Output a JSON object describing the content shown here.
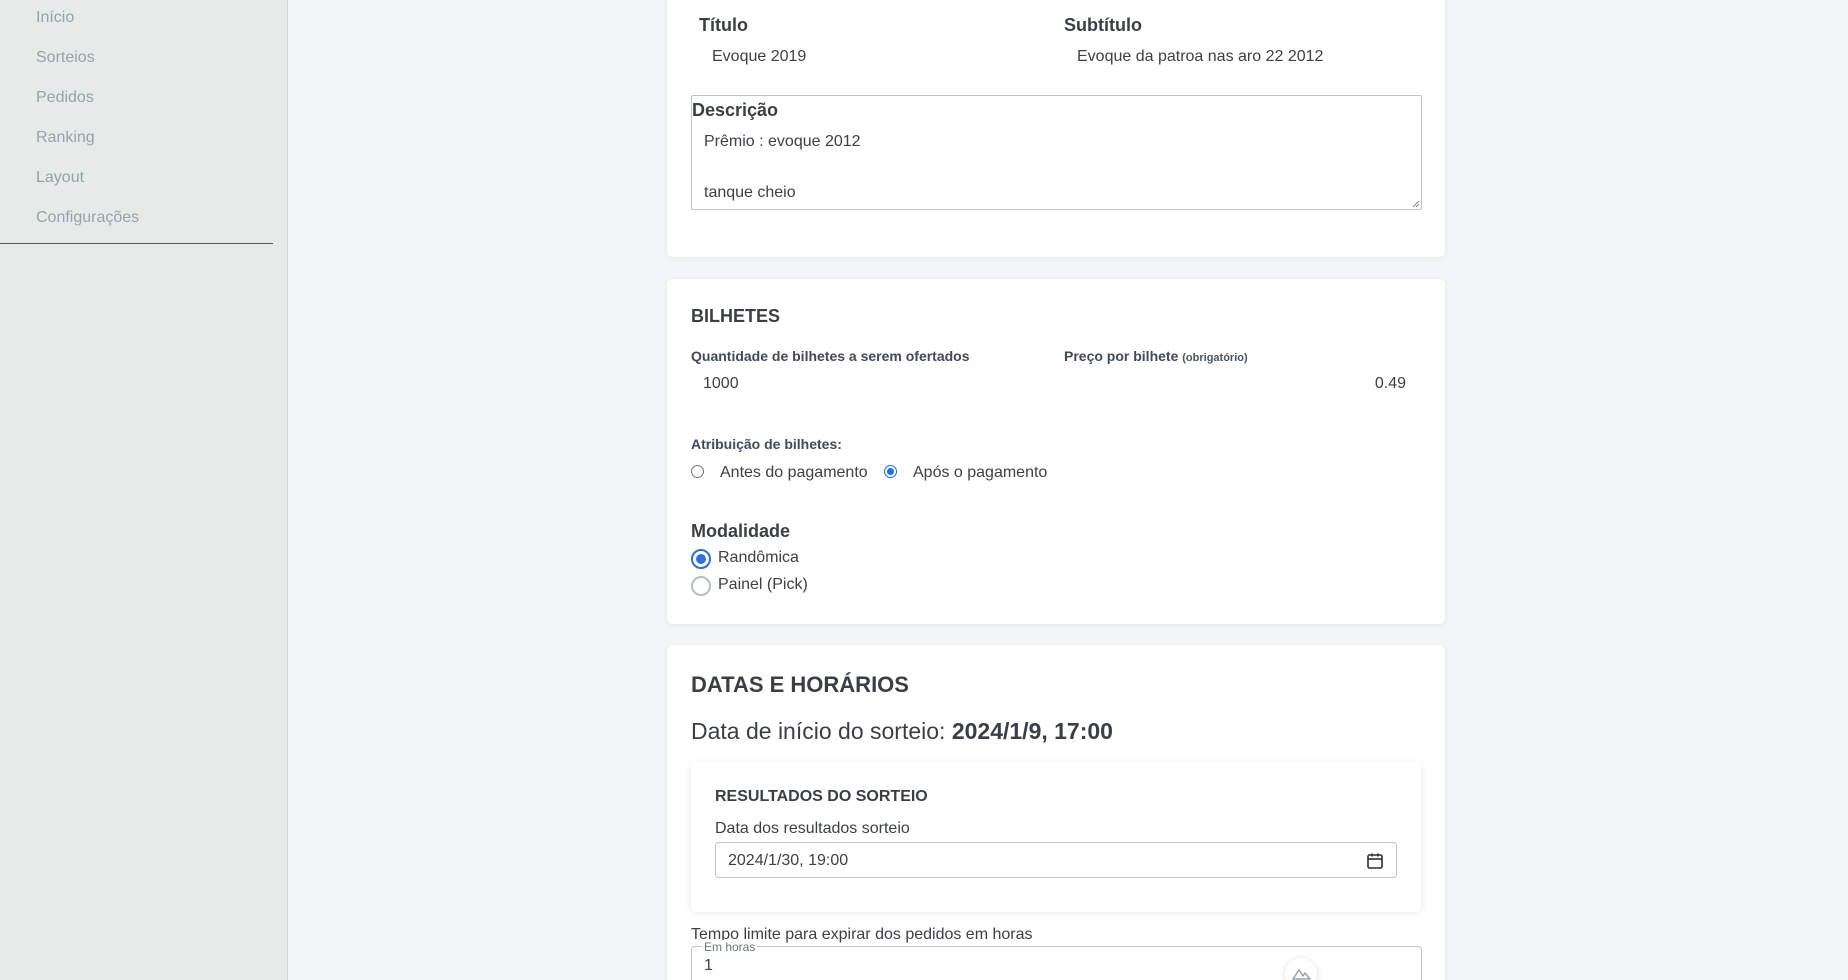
{
  "sidebar": {
    "items": [
      {
        "label": "Início"
      },
      {
        "label": "Sorteios"
      },
      {
        "label": "Pedidos"
      },
      {
        "label": "Ranking"
      },
      {
        "label": "Layout"
      },
      {
        "label": "Configurações"
      }
    ]
  },
  "info": {
    "title_label": "Título",
    "title_value": "Evoque 2019",
    "subtitle_label": "Subtítulo",
    "subtitle_value": "Evoque da patroa nas aro 22 2012",
    "description_label": "Descrição",
    "description_lines": [
      "Prêmio : evoque 2012",
      "tanque cheio"
    ]
  },
  "tickets": {
    "heading": "BILHETES",
    "quantity_label": "Quantidade de bilhetes a serem ofertados",
    "quantity_value": "1000",
    "price_label": "Preço por bilhete",
    "price_hint": "(obrigatório)",
    "price_value": "0.49",
    "assignment_label": "Atribuição de bilhetes:",
    "assignment_options": [
      {
        "label": "Antes do pagamento",
        "selected": false
      },
      {
        "label": "Após o pagamento",
        "selected": true
      }
    ],
    "mode_label": "Modalidade",
    "mode_options": [
      {
        "label": "Randômica",
        "selected": true
      },
      {
        "label": "Painel (Pick)",
        "selected": false
      }
    ]
  },
  "schedule": {
    "heading": "DATAS E HORÁRIOS",
    "start_prefix": "Data de início do sorteio:",
    "start_value": "2024/1/9, 17:00",
    "results": {
      "heading": "RESULTADOS DO SORTEIO",
      "date_label": "Data dos resultados sorteio",
      "date_value": "2024/1/30, 19:00"
    },
    "expire_label": "Tempo limite para expirar dos pedidos em horas",
    "expire_legend": "Em horas",
    "expire_value": "1"
  },
  "colors": {
    "accent": "#1a73e8",
    "sidebar_bg": "#e6ebea",
    "card_bg": "#ffffff"
  }
}
